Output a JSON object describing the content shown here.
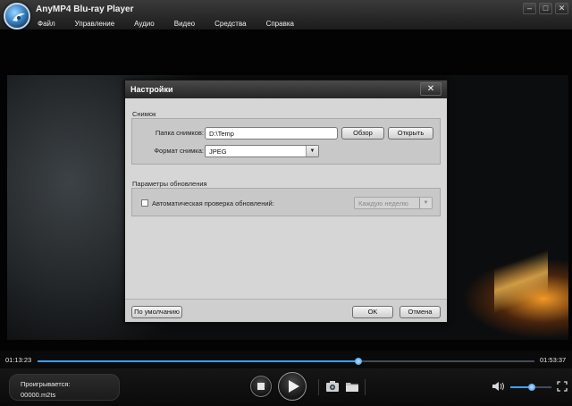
{
  "app": {
    "title": "AnyMP4 Blu-ray Player"
  },
  "menu": [
    "Файл",
    "Управление",
    "Аудио",
    "Видео",
    "Средства",
    "Справка"
  ],
  "window_controls": {
    "minimize": "–",
    "maximize": "□",
    "close": "✕"
  },
  "dialog": {
    "title": "Настройки",
    "close_label": "✕",
    "snapshot": {
      "section_label": "Снимок",
      "folder_label": "Папка снимков:",
      "folder_value": "D:\\Temp",
      "browse_label": "Обзор",
      "open_label": "Открыть",
      "format_label": "Формат снимка:",
      "format_value": "JPEG"
    },
    "updates": {
      "section_label": "Параметры обновления",
      "auto_check_label": "Автоматическая проверка обновлений:",
      "auto_check_checked": false,
      "frequency_value": "Каждую неделю"
    },
    "defaults_label": "По умолчанию",
    "ok_label": "OK",
    "cancel_label": "Отмена"
  },
  "playback": {
    "elapsed": "01:13:23",
    "total": "01:53:37",
    "progress_fraction": 0.645,
    "status_label": "Проигрывается:",
    "file_name": "00000.m2ts",
    "volume_fraction": 0.52
  },
  "colors": {
    "accent": "#3aa0ff",
    "dialog_bg": "#d6d6d6",
    "titlebar": "#262626"
  },
  "icons": [
    "logo-icon",
    "stop-icon",
    "play-icon",
    "camera-icon",
    "folder-icon",
    "speaker-icon",
    "fullscreen-icon"
  ]
}
